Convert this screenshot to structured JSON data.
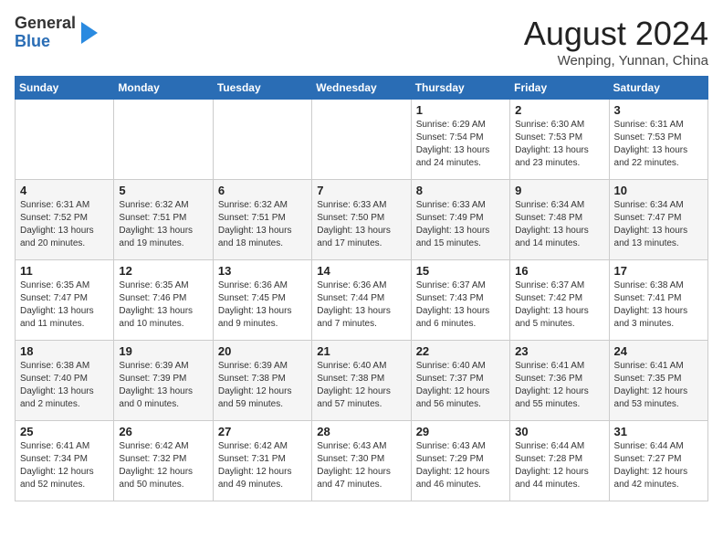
{
  "logo": {
    "general": "General",
    "blue": "Blue"
  },
  "title": "August 2024",
  "location": "Wenping, Yunnan, China",
  "days_of_week": [
    "Sunday",
    "Monday",
    "Tuesday",
    "Wednesday",
    "Thursday",
    "Friday",
    "Saturday"
  ],
  "weeks": [
    [
      {
        "day": "",
        "info": ""
      },
      {
        "day": "",
        "info": ""
      },
      {
        "day": "",
        "info": ""
      },
      {
        "day": "",
        "info": ""
      },
      {
        "day": "1",
        "info": "Sunrise: 6:29 AM\nSunset: 7:54 PM\nDaylight: 13 hours\nand 24 minutes."
      },
      {
        "day": "2",
        "info": "Sunrise: 6:30 AM\nSunset: 7:53 PM\nDaylight: 13 hours\nand 23 minutes."
      },
      {
        "day": "3",
        "info": "Sunrise: 6:31 AM\nSunset: 7:53 PM\nDaylight: 13 hours\nand 22 minutes."
      }
    ],
    [
      {
        "day": "4",
        "info": "Sunrise: 6:31 AM\nSunset: 7:52 PM\nDaylight: 13 hours\nand 20 minutes."
      },
      {
        "day": "5",
        "info": "Sunrise: 6:32 AM\nSunset: 7:51 PM\nDaylight: 13 hours\nand 19 minutes."
      },
      {
        "day": "6",
        "info": "Sunrise: 6:32 AM\nSunset: 7:51 PM\nDaylight: 13 hours\nand 18 minutes."
      },
      {
        "day": "7",
        "info": "Sunrise: 6:33 AM\nSunset: 7:50 PM\nDaylight: 13 hours\nand 17 minutes."
      },
      {
        "day": "8",
        "info": "Sunrise: 6:33 AM\nSunset: 7:49 PM\nDaylight: 13 hours\nand 15 minutes."
      },
      {
        "day": "9",
        "info": "Sunrise: 6:34 AM\nSunset: 7:48 PM\nDaylight: 13 hours\nand 14 minutes."
      },
      {
        "day": "10",
        "info": "Sunrise: 6:34 AM\nSunset: 7:47 PM\nDaylight: 13 hours\nand 13 minutes."
      }
    ],
    [
      {
        "day": "11",
        "info": "Sunrise: 6:35 AM\nSunset: 7:47 PM\nDaylight: 13 hours\nand 11 minutes."
      },
      {
        "day": "12",
        "info": "Sunrise: 6:35 AM\nSunset: 7:46 PM\nDaylight: 13 hours\nand 10 minutes."
      },
      {
        "day": "13",
        "info": "Sunrise: 6:36 AM\nSunset: 7:45 PM\nDaylight: 13 hours\nand 9 minutes."
      },
      {
        "day": "14",
        "info": "Sunrise: 6:36 AM\nSunset: 7:44 PM\nDaylight: 13 hours\nand 7 minutes."
      },
      {
        "day": "15",
        "info": "Sunrise: 6:37 AM\nSunset: 7:43 PM\nDaylight: 13 hours\nand 6 minutes."
      },
      {
        "day": "16",
        "info": "Sunrise: 6:37 AM\nSunset: 7:42 PM\nDaylight: 13 hours\nand 5 minutes."
      },
      {
        "day": "17",
        "info": "Sunrise: 6:38 AM\nSunset: 7:41 PM\nDaylight: 13 hours\nand 3 minutes."
      }
    ],
    [
      {
        "day": "18",
        "info": "Sunrise: 6:38 AM\nSunset: 7:40 PM\nDaylight: 13 hours\nand 2 minutes."
      },
      {
        "day": "19",
        "info": "Sunrise: 6:39 AM\nSunset: 7:39 PM\nDaylight: 13 hours\nand 0 minutes."
      },
      {
        "day": "20",
        "info": "Sunrise: 6:39 AM\nSunset: 7:38 PM\nDaylight: 12 hours\nand 59 minutes."
      },
      {
        "day": "21",
        "info": "Sunrise: 6:40 AM\nSunset: 7:38 PM\nDaylight: 12 hours\nand 57 minutes."
      },
      {
        "day": "22",
        "info": "Sunrise: 6:40 AM\nSunset: 7:37 PM\nDaylight: 12 hours\nand 56 minutes."
      },
      {
        "day": "23",
        "info": "Sunrise: 6:41 AM\nSunset: 7:36 PM\nDaylight: 12 hours\nand 55 minutes."
      },
      {
        "day": "24",
        "info": "Sunrise: 6:41 AM\nSunset: 7:35 PM\nDaylight: 12 hours\nand 53 minutes."
      }
    ],
    [
      {
        "day": "25",
        "info": "Sunrise: 6:41 AM\nSunset: 7:34 PM\nDaylight: 12 hours\nand 52 minutes."
      },
      {
        "day": "26",
        "info": "Sunrise: 6:42 AM\nSunset: 7:32 PM\nDaylight: 12 hours\nand 50 minutes."
      },
      {
        "day": "27",
        "info": "Sunrise: 6:42 AM\nSunset: 7:31 PM\nDaylight: 12 hours\nand 49 minutes."
      },
      {
        "day": "28",
        "info": "Sunrise: 6:43 AM\nSunset: 7:30 PM\nDaylight: 12 hours\nand 47 minutes."
      },
      {
        "day": "29",
        "info": "Sunrise: 6:43 AM\nSunset: 7:29 PM\nDaylight: 12 hours\nand 46 minutes."
      },
      {
        "day": "30",
        "info": "Sunrise: 6:44 AM\nSunset: 7:28 PM\nDaylight: 12 hours\nand 44 minutes."
      },
      {
        "day": "31",
        "info": "Sunrise: 6:44 AM\nSunset: 7:27 PM\nDaylight: 12 hours\nand 42 minutes."
      }
    ]
  ]
}
